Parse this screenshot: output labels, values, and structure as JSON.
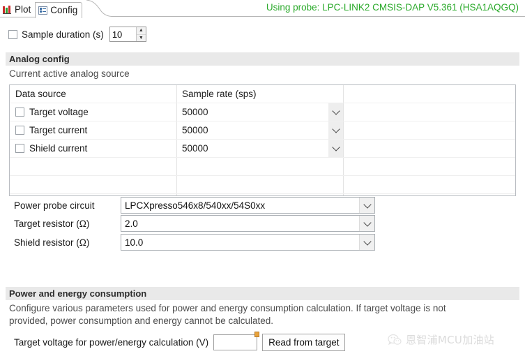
{
  "tabs": [
    {
      "label": "Plot",
      "icon": "bar-chart-icon",
      "active": false
    },
    {
      "label": "Config",
      "icon": "config-list-icon",
      "active": true
    }
  ],
  "status": {
    "probe_text": "Using probe: LPC-LINK2 CMSIS-DAP V5.361 (HSA1AQGQ)",
    "probe_color": "#2aa92a"
  },
  "sample_duration": {
    "checked": false,
    "label": "Sample duration (s)",
    "value": "10"
  },
  "analog_config": {
    "section_title": "Analog config",
    "subtitle": "Current active analog source",
    "table": {
      "headers": [
        "Data source",
        "Sample rate (sps)",
        ""
      ],
      "rows": [
        {
          "checked": false,
          "source": "Target voltage",
          "rate": "50000"
        },
        {
          "checked": false,
          "source": "Target current",
          "rate": "50000"
        },
        {
          "checked": false,
          "source": "Shield current",
          "rate": "50000"
        }
      ]
    },
    "combos": [
      {
        "label": "Power probe circuit",
        "value": "LPCXpresso546x8/540xx/54S0xx"
      },
      {
        "label": "Target resistor (Ω)",
        "value": "2.0"
      },
      {
        "label": "Shield resistor (Ω)",
        "value": "10.0"
      }
    ]
  },
  "power_energy": {
    "section_title": "Power and energy consumption",
    "description_line1": "Configure various parameters used for power and energy consumption calculation. If target voltage is not",
    "description_line2": "provided, power consumption and energy cannot be calculated.",
    "target_voltage_label": "Target voltage for power/energy calculation (V)",
    "target_voltage_value": "",
    "target_voltage_placeholder": "",
    "read_button_label": "Read from target"
  },
  "watermark": {
    "text": "恩智浦MCU加油站",
    "icon": "wechat-icon"
  }
}
